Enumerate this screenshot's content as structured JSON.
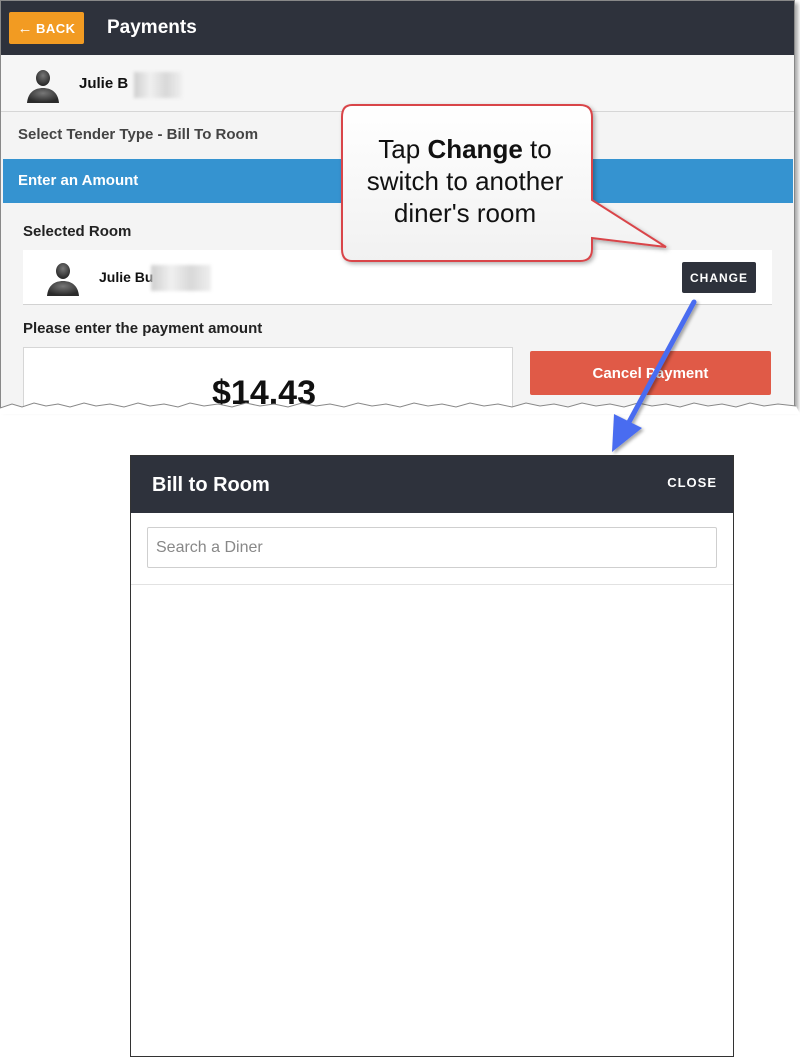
{
  "app": {
    "back_label": "BACK",
    "title": "Payments"
  },
  "user": {
    "name": "Julie B"
  },
  "tender": {
    "label": "Select Tender Type - Bill To Room"
  },
  "amount_section": {
    "header": "Enter an Amount",
    "selected_room_label": "Selected Room",
    "room_user_name": "Julie Bu",
    "change_label": "CHANGE",
    "payment_prompt": "Please enter the payment amount",
    "amount": "$14.43",
    "cancel_label": "Cancel Payment"
  },
  "callout": {
    "text_before": "Tap ",
    "text_bold": "Change",
    "text_after": " to switch to another diner's room"
  },
  "modal": {
    "title": "Bill to Room",
    "close_label": "CLOSE",
    "search_placeholder": "Search a Diner"
  },
  "colors": {
    "header_bg": "#2e323c",
    "back_button": "#f29b22",
    "section_bar": "#3593d0",
    "cancel_button": "#e05a47",
    "callout_border": "#d9454a",
    "arrow": "#4a6cf0"
  },
  "icons": {
    "back": "arrow-left-icon",
    "avatar": "user-silhouette-icon"
  }
}
